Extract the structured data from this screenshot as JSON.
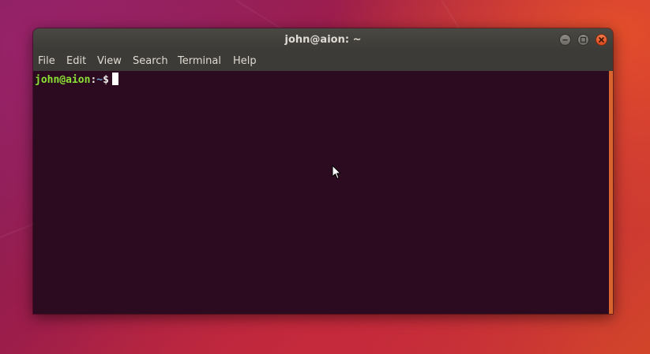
{
  "window": {
    "title": "john@aion: ~"
  },
  "menubar": {
    "items": [
      "File",
      "Edit",
      "View",
      "Search",
      "Terminal",
      "Help"
    ]
  },
  "terminal": {
    "prompt_user": "john@aion",
    "prompt_sep": ":",
    "prompt_path": "~",
    "prompt_symbol": "$"
  },
  "colors": {
    "terminal_bg": "#2c0a1f",
    "prompt_user": "#8ae234",
    "prompt_path": "#729fcf",
    "scrollbar_accent": "#d9652e",
    "close_button": "#e05a2b",
    "titlebar": "#3c3b37"
  },
  "icons": {
    "minimize": "minimize-icon",
    "maximize": "maximize-icon",
    "close": "close-icon",
    "pointer": "mouse-pointer-icon"
  }
}
